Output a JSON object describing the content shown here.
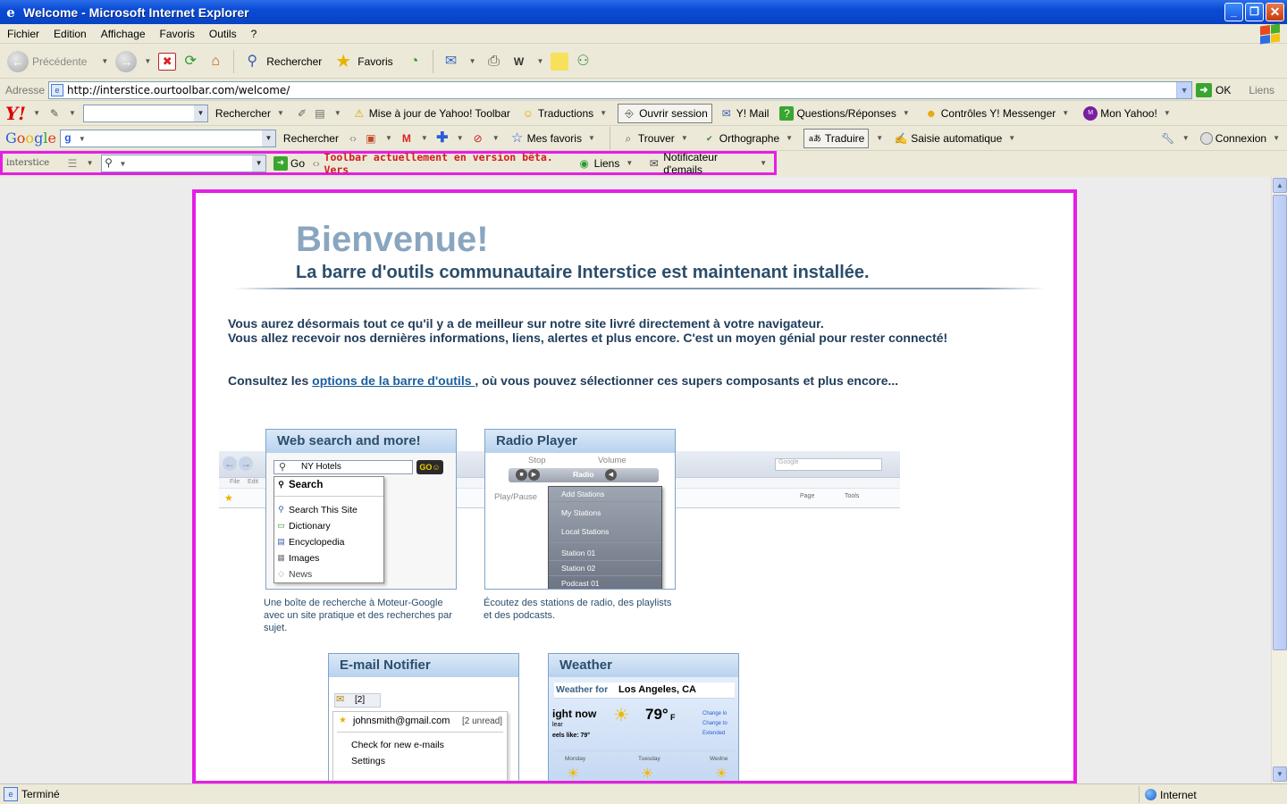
{
  "window": {
    "title": "Welcome - Microsoft Internet Explorer"
  },
  "menubar": {
    "items": [
      "Fichier",
      "Edition",
      "Affichage",
      "Favoris",
      "Outils",
      "?"
    ]
  },
  "toolbar": {
    "back_label": "Précédente",
    "search_label": "Rechercher",
    "favorites_label": "Favoris"
  },
  "address": {
    "label": "Adresse",
    "url": "http://interstice.ourtoolbar.com/welcome/",
    "go_label": "OK",
    "links_label": "Liens"
  },
  "yahoo_bar": {
    "search_button": "Rechercher",
    "update_label": "Mise à jour de Yahoo! Toolbar",
    "translations_label": "Traductions",
    "signin_label": "Ouvrir session",
    "mail_label": "Y! Mail",
    "answers_label": "Questions/Réponses",
    "messenger_label": "Contrôles Y! Messenger",
    "myyahoo_label": "Mon Yahoo!"
  },
  "google_bar": {
    "search_button": "Rechercher",
    "bookmarks_label": "Mes favoris",
    "find_label": "Trouver",
    "spell_label": "Orthographe",
    "translate_label": "Traduire",
    "autofill_label": "Saisie automatique",
    "signin_label": "Connexion"
  },
  "interstice_bar": {
    "logo_text": "interstice",
    "go_label": "Go",
    "beta_text": "Toolbar actuellement en version bêta. Vers",
    "links_label": "Liens",
    "notifier_label": "Notificateur d'emails"
  },
  "page": {
    "title": "Bienvenue!",
    "subtitle": "La barre d'outils communautaire Interstice est maintenant installée.",
    "line1": "Vous aurez désormais tout ce qu'il y a de meilleur sur notre site livré directement à votre navigateur.",
    "line2": "Vous allez recevoir nos dernières informations, liens, alertes et plus encore. C'est un moyen génial pour rester connecté!",
    "options_prefix": "Consultez les ",
    "options_link": "options de la barre d'outils ",
    "options_suffix": ", où vous pouvez sélectionner ces supers composants et plus encore...",
    "features": {
      "web_search": {
        "title": "Web search and more!",
        "query": "NY Hotels",
        "menu": [
          "Search",
          "Search This Site",
          "Dictionary",
          "Encyclopedia",
          "Images",
          "News"
        ],
        "caption": "Une boîte de recherche à Moteur-Google avec un site pratique et des recherches par sujet."
      },
      "radio": {
        "title": "Radio Player",
        "stop_label": "Stop",
        "volume_label": "Volume",
        "playpause_label": "Play/Pause",
        "radio_label": "Radio",
        "menu": [
          "Add Stations",
          "My Stations",
          "Local Stations",
          "Station 01",
          "Station 02",
          "Podcast 01"
        ],
        "caption": "Écoutez des stations de radio, des playlists et des podcasts."
      },
      "email": {
        "title": "E-mail Notifier",
        "count": "[2]",
        "account": "johnsmith@gmail.com",
        "unread": "[2 unread]",
        "check_label": "Check for new e-mails",
        "settings_label": "Settings"
      },
      "weather": {
        "title": "Weather",
        "weather_for": "Weather for",
        "city": "Los Angeles, CA",
        "now_label": "ight now",
        "temp": "79°",
        "unit": "F",
        "cond": "lear",
        "feels": "eels like: 79°",
        "links": [
          "Change lo",
          "Change to",
          "Extended"
        ],
        "days": [
          "Monday",
          "Tuesday",
          "Wedne"
        ]
      }
    },
    "mock_browser": {
      "search_placeholder": "Google",
      "page_label": "Page",
      "tools_label": "Tools",
      "file_label": "File",
      "edit_label": "Edit"
    }
  },
  "status": {
    "text": "Terminé",
    "zone": "Internet"
  },
  "colors": {
    "highlight": "#e51ee5",
    "title_blue": "#8aa6bf",
    "heading": "#2b4e6c"
  }
}
